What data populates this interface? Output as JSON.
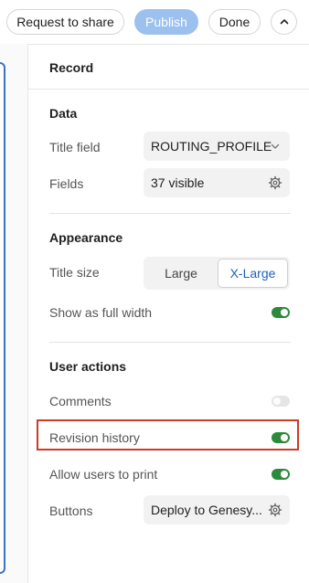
{
  "toolbar": {
    "request_share_label": "Request to share",
    "publish_label": "Publish",
    "done_label": "Done",
    "collapse_icon": "chevron-up-icon"
  },
  "panel": {
    "title": "Record",
    "data_section": {
      "title": "Data",
      "title_field_label": "Title field",
      "title_field_value": "ROUTING_PROFILE",
      "fields_label": "Fields",
      "fields_value": "37 visible"
    },
    "appearance_section": {
      "title": "Appearance",
      "title_size_label": "Title size",
      "title_size_options": [
        "Large",
        "X-Large"
      ],
      "title_size_selected": "X-Large",
      "full_width_label": "Show as full width",
      "full_width_on": true
    },
    "user_actions_section": {
      "title": "User actions",
      "comments_label": "Comments",
      "comments_on": false,
      "revision_history_label": "Revision history",
      "revision_history_on": true,
      "print_label": "Allow users to print",
      "print_on": true,
      "buttons_label": "Buttons",
      "buttons_value": "Deploy to Genesy..."
    }
  },
  "colors": {
    "accent_blue": "#9cc1ee",
    "selected_text": "#1e60b8",
    "toggle_on": "#2c8a3a",
    "highlight": "#cf3a22"
  }
}
